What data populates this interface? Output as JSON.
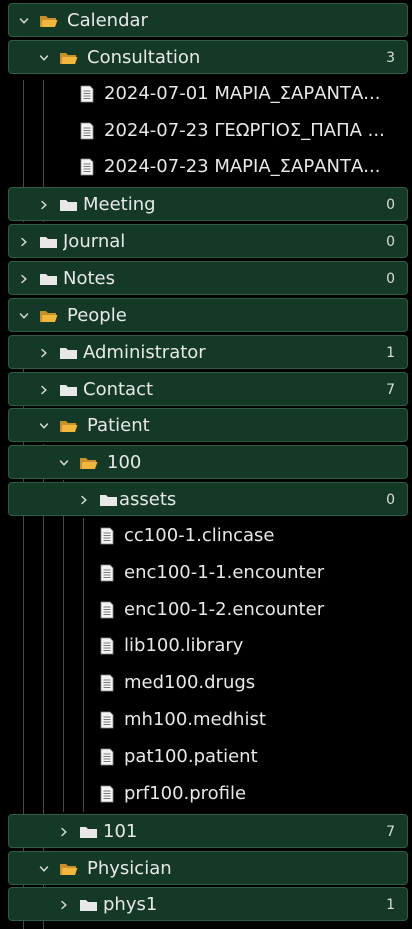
{
  "tree": {
    "rows": [
      {
        "kind": "folder",
        "name": "calendar",
        "label": "Calendar",
        "open": true,
        "depth": 0,
        "count": ""
      },
      {
        "kind": "folder",
        "name": "consultation",
        "label": "Consultation",
        "open": true,
        "depth": 1,
        "count": "3"
      },
      {
        "kind": "file",
        "name": "consultation-note-1",
        "label": "2024-07-01 ΜΑΡΙΑ_ΣΑΡΑΝΤΑ...",
        "depth": 2
      },
      {
        "kind": "file",
        "name": "consultation-note-2",
        "label": "2024-07-23 ΓΕΩΡΓΙΟΣ_ΠΑΠΑ ...",
        "depth": 2
      },
      {
        "kind": "file",
        "name": "consultation-note-3",
        "label": "2024-07-23 ΜΑΡΙΑ_ΣΑΡΑΝΤΑ...",
        "depth": 2
      },
      {
        "kind": "folder",
        "name": "meeting",
        "label": "Meeting",
        "open": false,
        "depth": 1,
        "count": "0"
      },
      {
        "kind": "folder",
        "name": "journal",
        "label": "Journal",
        "open": false,
        "depth": 0,
        "count": "0"
      },
      {
        "kind": "folder",
        "name": "notes",
        "label": "Notes",
        "open": false,
        "depth": 0,
        "count": "0"
      },
      {
        "kind": "folder",
        "name": "people",
        "label": "People",
        "open": true,
        "depth": 0,
        "count": ""
      },
      {
        "kind": "folder",
        "name": "administrator",
        "label": "Administrator",
        "open": false,
        "depth": 1,
        "count": "1"
      },
      {
        "kind": "folder",
        "name": "contact",
        "label": "Contact",
        "open": false,
        "depth": 1,
        "count": "7"
      },
      {
        "kind": "folder",
        "name": "patient",
        "label": "Patient",
        "open": true,
        "depth": 1,
        "count": ""
      },
      {
        "kind": "folder",
        "name": "patient-100",
        "label": "100",
        "open": true,
        "depth": 2,
        "count": ""
      },
      {
        "kind": "folder",
        "name": "assets",
        "label": "assets",
        "open": false,
        "depth": 3,
        "count": "0"
      },
      {
        "kind": "file",
        "name": "cc100-1",
        "label": "cc100-1.clincase",
        "depth": 3
      },
      {
        "kind": "file",
        "name": "enc100-1-1",
        "label": "enc100-1-1.encounter",
        "depth": 3
      },
      {
        "kind": "file",
        "name": "enc100-1-2",
        "label": "enc100-1-2.encounter",
        "depth": 3
      },
      {
        "kind": "file",
        "name": "lib100",
        "label": "lib100.library",
        "depth": 3
      },
      {
        "kind": "file",
        "name": "med100",
        "label": "med100.drugs",
        "depth": 3
      },
      {
        "kind": "file",
        "name": "mh100",
        "label": "mh100.medhist",
        "depth": 3
      },
      {
        "kind": "file",
        "name": "pat100",
        "label": "pat100.patient",
        "depth": 3
      },
      {
        "kind": "file",
        "name": "prf100",
        "label": "prf100.profile",
        "depth": 3
      },
      {
        "kind": "folder",
        "name": "patient-101",
        "label": "101",
        "open": false,
        "depth": 2,
        "count": "7"
      },
      {
        "kind": "folder",
        "name": "physician",
        "label": "Physician",
        "open": true,
        "depth": 1,
        "count": ""
      },
      {
        "kind": "folder",
        "name": "phys1",
        "label": "phys1",
        "open": false,
        "depth": 2,
        "count": "1"
      }
    ]
  },
  "colors": {
    "row_bg": "#143a27",
    "row_border": "#2e5c44",
    "folder_open": "#f2b63a",
    "folder_closed": "#e8e8e8",
    "text": "#e8e8e8"
  },
  "icons": {
    "open": "folder-open-icon",
    "closed": "folder-icon",
    "file": "document-icon",
    "expanded": "chevron-down-icon",
    "collapsed": "chevron-right-icon"
  }
}
